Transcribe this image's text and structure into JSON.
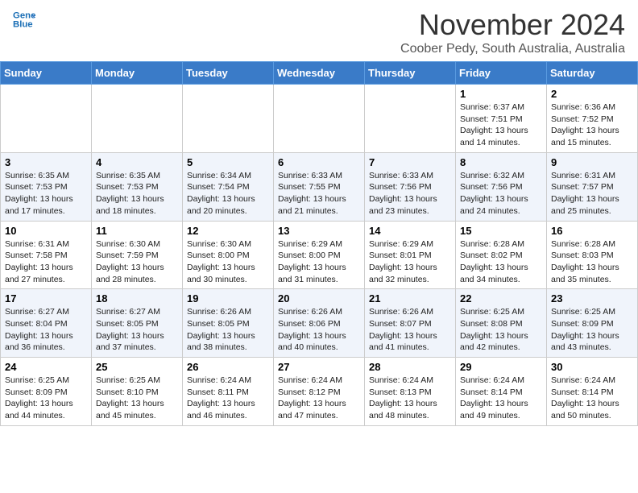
{
  "header": {
    "logo_line1": "General",
    "logo_line2": "Blue",
    "month": "November 2024",
    "location": "Coober Pedy, South Australia, Australia"
  },
  "days_of_week": [
    "Sunday",
    "Monday",
    "Tuesday",
    "Wednesday",
    "Thursday",
    "Friday",
    "Saturday"
  ],
  "weeks": [
    [
      {
        "day": "",
        "info": ""
      },
      {
        "day": "",
        "info": ""
      },
      {
        "day": "",
        "info": ""
      },
      {
        "day": "",
        "info": ""
      },
      {
        "day": "",
        "info": ""
      },
      {
        "day": "1",
        "info": "Sunrise: 6:37 AM\nSunset: 7:51 PM\nDaylight: 13 hours and 14 minutes."
      },
      {
        "day": "2",
        "info": "Sunrise: 6:36 AM\nSunset: 7:52 PM\nDaylight: 13 hours and 15 minutes."
      }
    ],
    [
      {
        "day": "3",
        "info": "Sunrise: 6:35 AM\nSunset: 7:53 PM\nDaylight: 13 hours and 17 minutes."
      },
      {
        "day": "4",
        "info": "Sunrise: 6:35 AM\nSunset: 7:53 PM\nDaylight: 13 hours and 18 minutes."
      },
      {
        "day": "5",
        "info": "Sunrise: 6:34 AM\nSunset: 7:54 PM\nDaylight: 13 hours and 20 minutes."
      },
      {
        "day": "6",
        "info": "Sunrise: 6:33 AM\nSunset: 7:55 PM\nDaylight: 13 hours and 21 minutes."
      },
      {
        "day": "7",
        "info": "Sunrise: 6:33 AM\nSunset: 7:56 PM\nDaylight: 13 hours and 23 minutes."
      },
      {
        "day": "8",
        "info": "Sunrise: 6:32 AM\nSunset: 7:56 PM\nDaylight: 13 hours and 24 minutes."
      },
      {
        "day": "9",
        "info": "Sunrise: 6:31 AM\nSunset: 7:57 PM\nDaylight: 13 hours and 25 minutes."
      }
    ],
    [
      {
        "day": "10",
        "info": "Sunrise: 6:31 AM\nSunset: 7:58 PM\nDaylight: 13 hours and 27 minutes."
      },
      {
        "day": "11",
        "info": "Sunrise: 6:30 AM\nSunset: 7:59 PM\nDaylight: 13 hours and 28 minutes."
      },
      {
        "day": "12",
        "info": "Sunrise: 6:30 AM\nSunset: 8:00 PM\nDaylight: 13 hours and 30 minutes."
      },
      {
        "day": "13",
        "info": "Sunrise: 6:29 AM\nSunset: 8:00 PM\nDaylight: 13 hours and 31 minutes."
      },
      {
        "day": "14",
        "info": "Sunrise: 6:29 AM\nSunset: 8:01 PM\nDaylight: 13 hours and 32 minutes."
      },
      {
        "day": "15",
        "info": "Sunrise: 6:28 AM\nSunset: 8:02 PM\nDaylight: 13 hours and 34 minutes."
      },
      {
        "day": "16",
        "info": "Sunrise: 6:28 AM\nSunset: 8:03 PM\nDaylight: 13 hours and 35 minutes."
      }
    ],
    [
      {
        "day": "17",
        "info": "Sunrise: 6:27 AM\nSunset: 8:04 PM\nDaylight: 13 hours and 36 minutes."
      },
      {
        "day": "18",
        "info": "Sunrise: 6:27 AM\nSunset: 8:05 PM\nDaylight: 13 hours and 37 minutes."
      },
      {
        "day": "19",
        "info": "Sunrise: 6:26 AM\nSunset: 8:05 PM\nDaylight: 13 hours and 38 minutes."
      },
      {
        "day": "20",
        "info": "Sunrise: 6:26 AM\nSunset: 8:06 PM\nDaylight: 13 hours and 40 minutes."
      },
      {
        "day": "21",
        "info": "Sunrise: 6:26 AM\nSunset: 8:07 PM\nDaylight: 13 hours and 41 minutes."
      },
      {
        "day": "22",
        "info": "Sunrise: 6:25 AM\nSunset: 8:08 PM\nDaylight: 13 hours and 42 minutes."
      },
      {
        "day": "23",
        "info": "Sunrise: 6:25 AM\nSunset: 8:09 PM\nDaylight: 13 hours and 43 minutes."
      }
    ],
    [
      {
        "day": "24",
        "info": "Sunrise: 6:25 AM\nSunset: 8:09 PM\nDaylight: 13 hours and 44 minutes."
      },
      {
        "day": "25",
        "info": "Sunrise: 6:25 AM\nSunset: 8:10 PM\nDaylight: 13 hours and 45 minutes."
      },
      {
        "day": "26",
        "info": "Sunrise: 6:24 AM\nSunset: 8:11 PM\nDaylight: 13 hours and 46 minutes."
      },
      {
        "day": "27",
        "info": "Sunrise: 6:24 AM\nSunset: 8:12 PM\nDaylight: 13 hours and 47 minutes."
      },
      {
        "day": "28",
        "info": "Sunrise: 6:24 AM\nSunset: 8:13 PM\nDaylight: 13 hours and 48 minutes."
      },
      {
        "day": "29",
        "info": "Sunrise: 6:24 AM\nSunset: 8:14 PM\nDaylight: 13 hours and 49 minutes."
      },
      {
        "day": "30",
        "info": "Sunrise: 6:24 AM\nSunset: 8:14 PM\nDaylight: 13 hours and 50 minutes."
      }
    ]
  ]
}
